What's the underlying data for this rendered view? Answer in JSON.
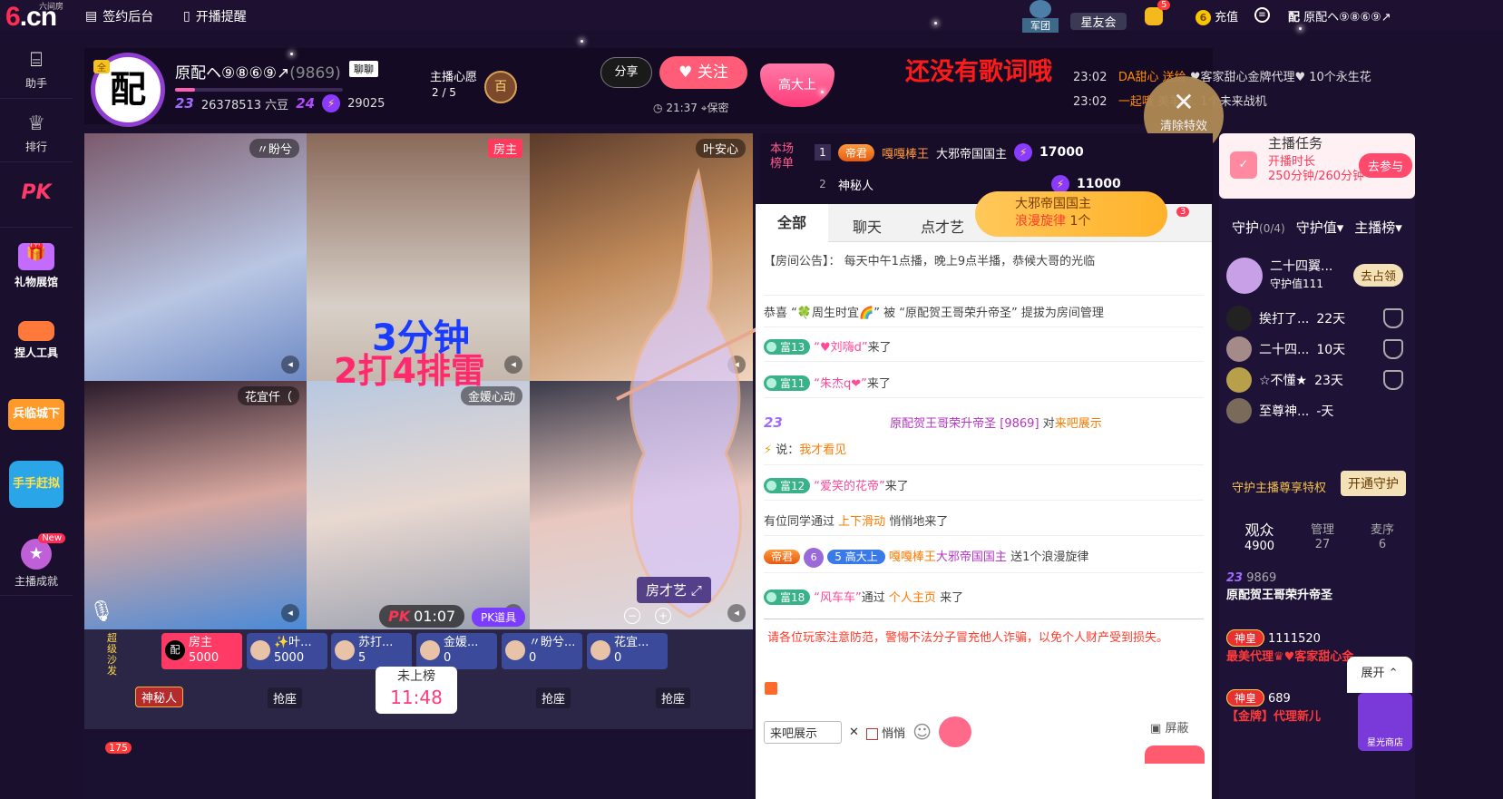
{
  "topbar": {
    "logo_prefix": "6",
    "logo_suffix": ".cn",
    "logo_tag": "六间房",
    "sign_backstage": "签约后台",
    "broadcast_reminder": "开播提醒",
    "army": "军团",
    "star_club": "星友会",
    "bell_count": "5",
    "recharge": "充值",
    "user_name": "原配ヘ⑨⑧⑥⑨↗"
  },
  "leftnav": [
    {
      "label": "助手",
      "icon": "robot-icon"
    },
    {
      "label": "排行",
      "icon": "crown-icon"
    },
    {
      "label": "PK",
      "icon": "pk-icon"
    },
    {
      "label": "礼物展馆",
      "icon": "gift-icon"
    },
    {
      "label": "捏人工具",
      "icon": "face-tool-icon"
    },
    {
      "label": "兵临城下",
      "icon": "castle-icon"
    },
    {
      "label": "手手赶拟",
      "icon": "game-icon"
    },
    {
      "label": "主播成就",
      "icon": "medal-icon",
      "badge": "New"
    }
  ],
  "header": {
    "avatar_char": "配",
    "avatar_tag": "全",
    "name": "原配ヘ⑨⑧⑥⑨↗",
    "room_id": "(9869)",
    "chat_tag": "聊聊",
    "level1": "23",
    "beans": "26378513 六豆",
    "level2": "24",
    "fans": "29025",
    "wish_label": "主播心愿",
    "wish_progress": "2 / 5",
    "wish_icon": "百",
    "share": "分享",
    "follow": "关注",
    "time": "21:37",
    "location": "保密",
    "gem_text": "高大上",
    "lyrics": "还没有歌词哦",
    "feed": [
      {
        "time": "23:02",
        "text": "DA甜心 送给",
        "gift": "♥客家甜心金牌代理♥ 10个永生花"
      },
      {
        "time": "23:02",
        "text": "一起哦",
        "gift": "美羊羊. 1个未来战机"
      }
    ],
    "clear_fx": "清除特效",
    "clear_x": "✕"
  },
  "video": {
    "cells": [
      {
        "name": "〃盼兮"
      },
      {
        "name": "房主"
      },
      {
        "name": "叶安心"
      },
      {
        "name": "花宜仟（"
      },
      {
        "name": "金媛心动"
      },
      {
        "name": ""
      }
    ],
    "overlay1": "3分钟",
    "overlay2": "2打4排雷",
    "pk_label": "PK",
    "timer": "01:07",
    "pk_tool": "PK道具",
    "room_art": "房才艺"
  },
  "seats": {
    "super_label": "超级沙发",
    "mysterious": "神秘人",
    "clock_label": "未上榜",
    "clock_time": "11:48",
    "grab": "抢座",
    "chips": [
      {
        "name": "房主",
        "value": "5000",
        "av": "配"
      },
      {
        "name": "✨叶...",
        "value": "5000",
        "av": ""
      },
      {
        "name": "苏打...",
        "value": "5",
        "av": ""
      },
      {
        "name": "金媛...",
        "value": "0",
        "av": ""
      },
      {
        "name": "〃盼兮...",
        "value": "0",
        "av": ""
      },
      {
        "name": "花宜...",
        "value": "0",
        "av": ""
      }
    ],
    "bottom_count": "175"
  },
  "rank": {
    "label": "本场榜单",
    "rows": [
      {
        "num": "1",
        "badge": "帝君",
        "who": "嘎嘎棒王",
        "title": "大邪帝国国主",
        "score": "17000"
      },
      {
        "num": "2",
        "badge": "",
        "who": "神秘人",
        "title": "",
        "score": "11000"
      }
    ]
  },
  "promo": {
    "line1": "大邪帝国国主",
    "line2": "浪漫旋律",
    "count": "1个",
    "badge": "3"
  },
  "chat": {
    "tabs": [
      "全部",
      "聊天",
      "点才艺"
    ],
    "notice": "【房间公告】： 每天中午1点播，晚上9点半播，恭候大哥的光临",
    "messages": [
      {
        "type": "text",
        "text": "恭喜 “🍀周生时宜🌈” 被 “原配贺王哥荣升帝圣” 提拔为房间管理"
      },
      {
        "type": "join",
        "level": "富13",
        "name": "“♥刘嗨d”",
        "tail": "来了"
      },
      {
        "type": "join",
        "level": "富11",
        "name": "“朱杰q❤”",
        "tail": "来了"
      },
      {
        "type": "vip",
        "level": "23",
        "name": "原配贺王哥荣升帝圣",
        "id": "[9869]",
        "action": "对",
        "target": "来吧展示",
        "say_label": "说：",
        "say": "我才看见"
      },
      {
        "type": "join",
        "level": "富12",
        "name": "“爱笑的花帝”",
        "tail": "来了"
      },
      {
        "type": "slide",
        "text": "有位同学通过",
        "link": "上下滑动",
        "tail": "悄悄地来了"
      },
      {
        "type": "gift",
        "badge1": "帝君",
        "badge2": "6",
        "badge3": "5 高大上",
        "name": "嘎嘎棒王",
        "title": "大邪帝国国主",
        "gift": "送1个浪漫旋律"
      },
      {
        "type": "join2",
        "level": "富18",
        "name": "“风车车”",
        "tail": "通过",
        "link": "个人主页",
        "tail2": "来了"
      }
    ],
    "warning": "请各位玩家注意防范，警惕不法分子冒充他人诈骗，以免个人财产受到损失。",
    "input_value": "来吧展示",
    "quiet": "悄悄",
    "shield": "屏蔽"
  },
  "right": {
    "task": {
      "title": "主播任务",
      "line1": "开播时长",
      "line2": "250分钟/260分钟",
      "go": "去参与"
    },
    "guard_tabs": {
      "guard": "守护",
      "guard_count": "(0/4)",
      "value": "守护值",
      "host_rank": "主播榜"
    },
    "top_guard": {
      "name": "二十四翼...",
      "value": "守护值111",
      "occupy": "去占领"
    },
    "guards": [
      {
        "name": "挨打了...",
        "days": "22天"
      },
      {
        "name": "二十四...",
        "days": "10天"
      },
      {
        "name": "☆不懂★",
        "days": "23天"
      },
      {
        "name": "至尊神...",
        "days": "-天"
      }
    ],
    "privilege": "守护主播尊享特权",
    "open_guard": "开通守护",
    "aud": [
      {
        "label": "观众",
        "count": "4900"
      },
      {
        "label": "管理",
        "count": "27"
      },
      {
        "label": "麦序",
        "count": "6"
      }
    ],
    "users": [
      {
        "id": "9869",
        "name": "原配贺王哥荣升帝圣"
      },
      {
        "badge": "神皇",
        "id": "1111520",
        "name": "最美代理♛♥客家甜心金"
      },
      {
        "badge": "神皇",
        "id": "689",
        "name": "【金牌】代理新儿"
      }
    ],
    "expand": "展开",
    "shop": "星光商店"
  }
}
